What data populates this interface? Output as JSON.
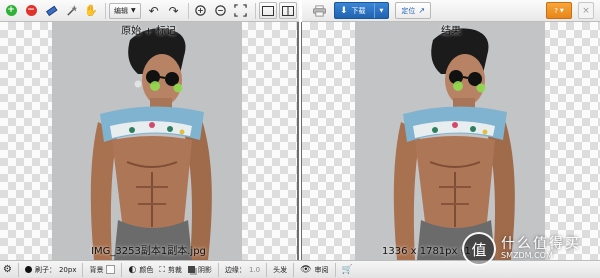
{
  "left_toolbar": {
    "icons": [
      "add-icon",
      "remove-icon",
      "eraser-icon",
      "magic-wand-icon",
      "hand-icon"
    ],
    "edit_dropdown_label": "编辑",
    "edit_icons": [
      "undo-icon",
      "redo-icon"
    ],
    "zoom_icons": [
      "zoom-in-icon",
      "zoom-out-icon",
      "fit-screen-icon"
    ],
    "view_icons": [
      "single-view-icon",
      "split-view-icon"
    ]
  },
  "right_toolbar": {
    "print_icon": "print-icon",
    "download_label": "下载",
    "locate_label": "定位",
    "help_label": "?",
    "close_label": "×"
  },
  "left_canvas": {
    "title": "原始 + 标记",
    "caption": "IMG_3253副本1副本.jpg"
  },
  "right_canvas": {
    "title": "结果",
    "caption": "1336 x 1781px (1"
  },
  "bottom_bar": {
    "brush_label": "刷子：",
    "brush_value": "20px",
    "background_label": "背景",
    "color_label": "颜色",
    "cut_label": "剪裁",
    "shadow_label": "阴影",
    "edge_label": "边缘：",
    "edge_value": "1.0",
    "hair_label": "头发",
    "review_label": "审阅"
  },
  "watermark": {
    "seal_char": "值",
    "main_text": "什么值得买",
    "domain_text": "SMZDM.COM"
  },
  "colors": {
    "add": "#2eb135",
    "remove": "#e0322a",
    "accent_blue": "#1f62b0",
    "orange": "#f39a2c"
  }
}
